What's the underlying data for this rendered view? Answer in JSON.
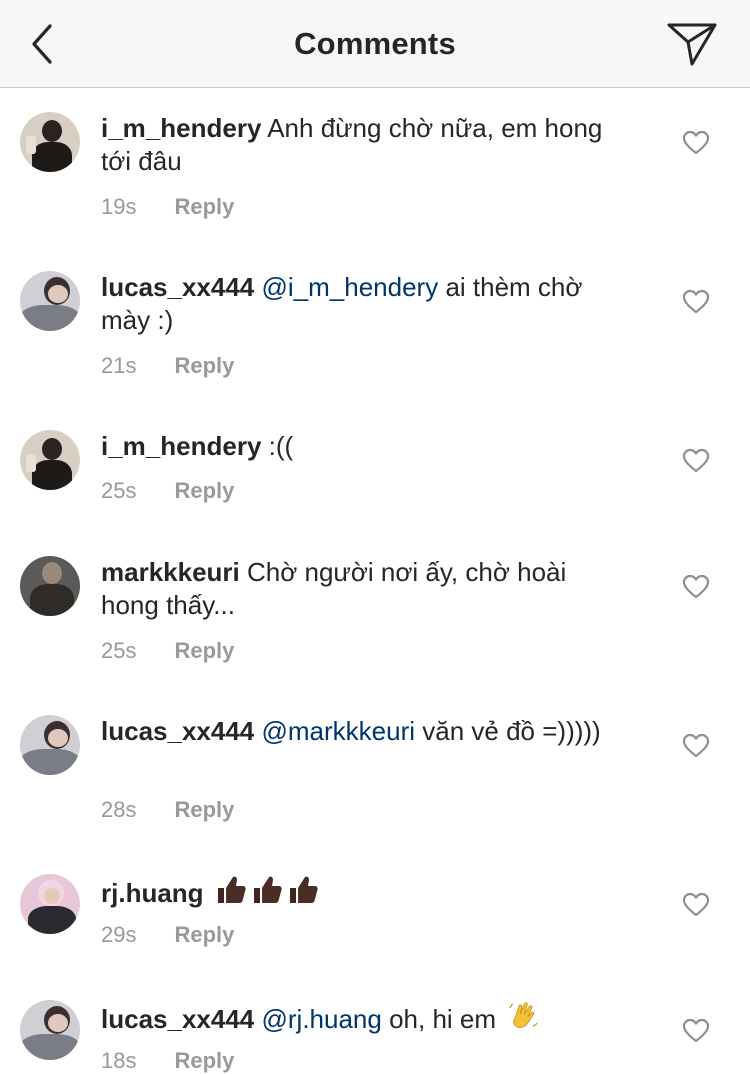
{
  "header": {
    "title": "Comments",
    "back_icon": "chevron-left-icon",
    "share_icon": "paper-plane-icon"
  },
  "colors": {
    "text": "#262626",
    "mention": "#003569",
    "meta": "#999999",
    "header_bg": "#f7f7f7"
  },
  "comments": [
    {
      "username": "i_m_hendery",
      "mention": "",
      "text": "Anh đừng chờ nữa, em hong tới đâu",
      "time": "19s",
      "reply_label": "Reply"
    },
    {
      "username": "lucas_xx444",
      "mention": "@i_m_hendery",
      "text": "ai thèm chờ mày :)",
      "time": "21s",
      "reply_label": "Reply"
    },
    {
      "username": "i_m_hendery",
      "mention": "",
      "text": " :((",
      "time": "25s",
      "reply_label": "Reply"
    },
    {
      "username": "markkkeuri",
      "mention": "",
      "text": "Chờ người nơi ấy, chờ hoài hong thấy...",
      "time": "25s",
      "reply_label": "Reply"
    },
    {
      "username": "lucas_xx444",
      "mention": "@markkkeuri",
      "text": "văn vẻ đồ =)))))",
      "time": "28s",
      "reply_label": "Reply"
    },
    {
      "username": "rj.huang",
      "mention": "",
      "text": "",
      "emoji": "thumbs-up-icon ×3",
      "time": "29s",
      "reply_label": "Reply"
    },
    {
      "username": "lucas_xx444",
      "mention": "@rj.huang",
      "text": "oh, hi em",
      "emoji": "waving-hand-icon",
      "time": "18s",
      "reply_label": "Reply"
    }
  ]
}
